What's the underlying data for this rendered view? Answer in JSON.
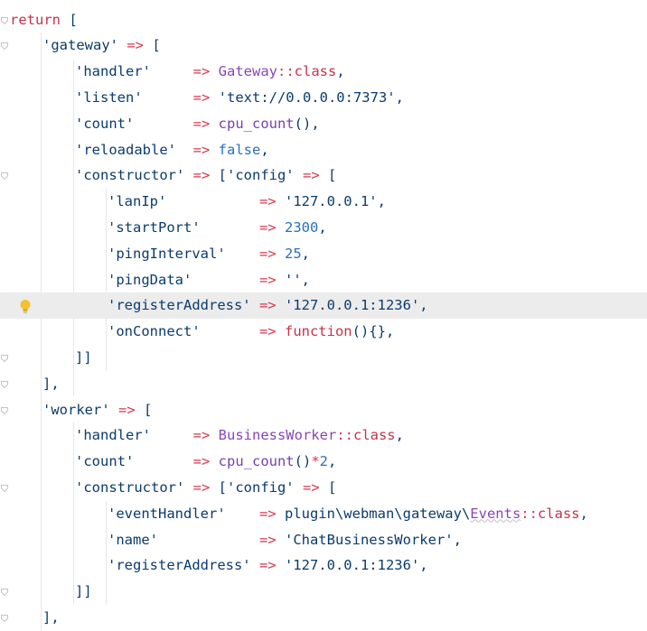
{
  "lines": [
    {
      "id": "l1",
      "tokens": [
        {
          "t": "return",
          "c": "kw"
        },
        {
          "t": " [",
          "c": "punc"
        }
      ]
    },
    {
      "id": "l2",
      "indent": 1,
      "tokens": [
        {
          "t": "'gateway'",
          "c": "str"
        },
        {
          "t": " => ",
          "c": "op"
        },
        {
          "t": "[",
          "c": "punc"
        }
      ]
    },
    {
      "id": "l3",
      "indent": 2,
      "tokens": [
        {
          "t": "'handler'",
          "c": "str"
        },
        {
          "t": "     => ",
          "c": "op"
        },
        {
          "t": "Gateway",
          "c": "cls"
        },
        {
          "t": "::",
          "c": "op"
        },
        {
          "t": "class",
          "c": "kw"
        },
        {
          "t": ",",
          "c": "punc"
        }
      ]
    },
    {
      "id": "l4",
      "indent": 2,
      "tokens": [
        {
          "t": "'listen'",
          "c": "str"
        },
        {
          "t": "      => ",
          "c": "op"
        },
        {
          "t": "'text://0.0.0.0:7373'",
          "c": "str"
        },
        {
          "t": ",",
          "c": "punc"
        }
      ]
    },
    {
      "id": "l5",
      "indent": 2,
      "tokens": [
        {
          "t": "'count'",
          "c": "str"
        },
        {
          "t": "       => ",
          "c": "op"
        },
        {
          "t": "cpu_count",
          "c": "fn"
        },
        {
          "t": "(),",
          "c": "punc"
        }
      ]
    },
    {
      "id": "l6",
      "indent": 2,
      "tokens": [
        {
          "t": "'reloadable'",
          "c": "str"
        },
        {
          "t": "  => ",
          "c": "op"
        },
        {
          "t": "false",
          "c": "bool"
        },
        {
          "t": ",",
          "c": "punc"
        }
      ]
    },
    {
      "id": "l7",
      "indent": 2,
      "tokens": [
        {
          "t": "'constructor'",
          "c": "str"
        },
        {
          "t": " => ",
          "c": "op"
        },
        {
          "t": "['config'",
          "c": "str"
        },
        {
          "t": " => ",
          "c": "op"
        },
        {
          "t": "[",
          "c": "punc"
        }
      ]
    },
    {
      "id": "l8",
      "indent": 3,
      "tokens": [
        {
          "t": "'lanIp'",
          "c": "str"
        },
        {
          "t": "           => ",
          "c": "op"
        },
        {
          "t": "'127.0.0.1'",
          "c": "str"
        },
        {
          "t": ",",
          "c": "punc"
        }
      ]
    },
    {
      "id": "l9",
      "indent": 3,
      "tokens": [
        {
          "t": "'startPort'",
          "c": "str"
        },
        {
          "t": "       => ",
          "c": "op"
        },
        {
          "t": "2300",
          "c": "num"
        },
        {
          "t": ",",
          "c": "punc"
        }
      ]
    },
    {
      "id": "l10",
      "indent": 3,
      "tokens": [
        {
          "t": "'pingInterval'",
          "c": "str"
        },
        {
          "t": "    => ",
          "c": "op"
        },
        {
          "t": "25",
          "c": "num"
        },
        {
          "t": ",",
          "c": "punc"
        }
      ]
    },
    {
      "id": "l11",
      "indent": 3,
      "tokens": [
        {
          "t": "'pingData'",
          "c": "str"
        },
        {
          "t": "        => ",
          "c": "op"
        },
        {
          "t": "''",
          "c": "str"
        },
        {
          "t": ",",
          "c": "punc"
        }
      ]
    },
    {
      "id": "l12",
      "indent": 3,
      "highlight": true,
      "bulb": true,
      "tokens": [
        {
          "t": "'registerAddress'",
          "c": "str"
        },
        {
          "t": " => ",
          "c": "op"
        },
        {
          "t": "'127.0.0.1:1236'",
          "c": "str"
        },
        {
          "t": ",",
          "c": "punc"
        }
      ]
    },
    {
      "id": "l13",
      "indent": 3,
      "tokens": [
        {
          "t": "'onConnect'",
          "c": "str"
        },
        {
          "t": "       => ",
          "c": "op"
        },
        {
          "t": "function",
          "c": "kw"
        },
        {
          "t": "(){},",
          "c": "punc"
        }
      ]
    },
    {
      "id": "l14",
      "indent": 2,
      "tokens": [
        {
          "t": "]]",
          "c": "punc"
        }
      ]
    },
    {
      "id": "l15",
      "indent": 1,
      "tokens": [
        {
          "t": "],",
          "c": "punc"
        }
      ]
    },
    {
      "id": "l16",
      "indent": 1,
      "tokens": [
        {
          "t": "'worker'",
          "c": "str"
        },
        {
          "t": " => ",
          "c": "op"
        },
        {
          "t": "[",
          "c": "punc"
        }
      ]
    },
    {
      "id": "l17",
      "indent": 2,
      "tokens": [
        {
          "t": "'handler'",
          "c": "str"
        },
        {
          "t": "     => ",
          "c": "op"
        },
        {
          "t": "BusinessWorker",
          "c": "cls"
        },
        {
          "t": "::",
          "c": "op"
        },
        {
          "t": "class",
          "c": "kw"
        },
        {
          "t": ",",
          "c": "punc"
        }
      ]
    },
    {
      "id": "l18",
      "indent": 2,
      "tokens": [
        {
          "t": "'count'",
          "c": "str"
        },
        {
          "t": "       => ",
          "c": "op"
        },
        {
          "t": "cpu_count",
          "c": "fn"
        },
        {
          "t": "()",
          "c": "punc"
        },
        {
          "t": "*",
          "c": "op"
        },
        {
          "t": "2",
          "c": "num"
        },
        {
          "t": ",",
          "c": "punc"
        }
      ]
    },
    {
      "id": "l19",
      "indent": 2,
      "tokens": [
        {
          "t": "'constructor'",
          "c": "str"
        },
        {
          "t": " => ",
          "c": "op"
        },
        {
          "t": "['config'",
          "c": "str"
        },
        {
          "t": " => ",
          "c": "op"
        },
        {
          "t": "[",
          "c": "punc"
        }
      ]
    },
    {
      "id": "l20",
      "indent": 3,
      "tokens": [
        {
          "t": "'eventHandler'",
          "c": "str"
        },
        {
          "t": "    => ",
          "c": "op"
        },
        {
          "t": "plugin\\webman\\gateway\\",
          "c": "ns"
        },
        {
          "t": "Events",
          "c": "cls",
          "sq": true
        },
        {
          "t": "::",
          "c": "op"
        },
        {
          "t": "class",
          "c": "kw"
        },
        {
          "t": ",",
          "c": "punc"
        }
      ]
    },
    {
      "id": "l21",
      "indent": 3,
      "tokens": [
        {
          "t": "'name'",
          "c": "str"
        },
        {
          "t": "            => ",
          "c": "op"
        },
        {
          "t": "'ChatBusinessWorker'",
          "c": "str"
        },
        {
          "t": ",",
          "c": "punc"
        }
      ]
    },
    {
      "id": "l22",
      "indent": 3,
      "tokens": [
        {
          "t": "'registerAddress'",
          "c": "str"
        },
        {
          "t": " => ",
          "c": "op"
        },
        {
          "t": "'127.0.0.1:1236'",
          "c": "str"
        },
        {
          "t": ",",
          "c": "punc"
        }
      ]
    },
    {
      "id": "l23",
      "indent": 2,
      "tokens": [
        {
          "t": "]]",
          "c": "punc"
        }
      ]
    },
    {
      "id": "l24",
      "indent": 1,
      "tokens": [
        {
          "t": "],",
          "c": "punc"
        }
      ]
    }
  ],
  "folds": [
    "l1",
    "l2",
    "l7",
    "l14",
    "l15",
    "l16",
    "l19",
    "l23",
    "l24"
  ],
  "icons": {
    "bulb": "lightbulb-icon",
    "fold": "fold-marker-icon"
  },
  "colors": {
    "keyword": "#c8324a",
    "string": "#0b3b6e",
    "operator": "#d6394e",
    "class": "#8a45b8",
    "number": "#2a6fc0",
    "highlight": "#ececec"
  }
}
